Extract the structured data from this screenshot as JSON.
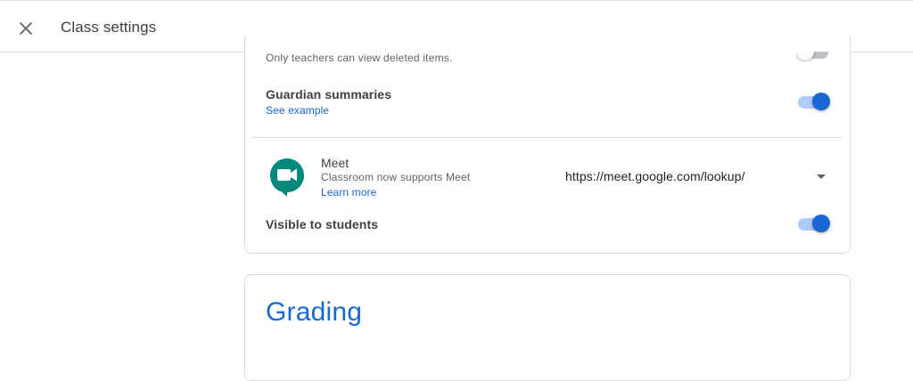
{
  "header": {
    "title": "Class settings",
    "close_icon": "close-icon"
  },
  "general": {
    "deleted_items_desc": "Only teachers can view deleted items.",
    "deleted_items_toggle": "off",
    "guardian_summaries_label": "Guardian summaries",
    "guardian_summaries_link": "See example",
    "guardian_summaries_toggle": "on"
  },
  "meet": {
    "icon": "google-meet-icon",
    "title": "Meet",
    "subtitle": "Classroom now supports Meet",
    "learn_more": "Learn more",
    "link_value": "https://meet.google.com/lookup/",
    "dropdown_icon": "dropdown-arrow-icon",
    "visible_label": "Visible to students",
    "visible_toggle": "on"
  },
  "grading": {
    "title": "Grading"
  },
  "colors": {
    "accent": "#1967d2",
    "accent_track": "#aecbfa",
    "meet_green": "#00897b",
    "border": "#dadce0"
  }
}
